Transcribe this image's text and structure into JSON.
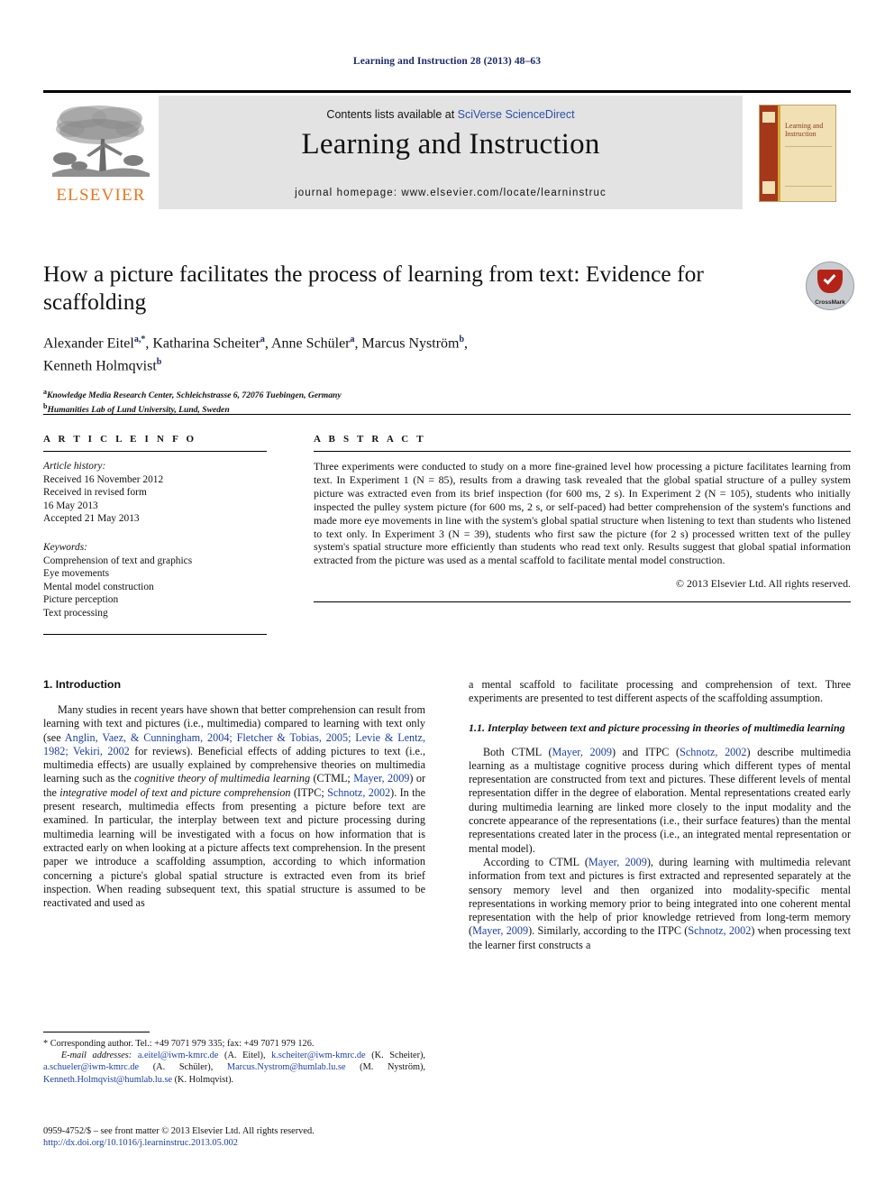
{
  "running_head": "Learning and Instruction 28 (2013) 48–63",
  "masthead": {
    "contents_prefix": "Contents lists available at ",
    "contents_link": "SciVerse ScienceDirect",
    "journal_title": "Learning and Instruction",
    "homepage": "journal homepage: www.elsevier.com/locate/learninstruc",
    "publisher_wordmark": "ELSEVIER",
    "cover_title": "Learning and Instruction"
  },
  "crossmark": {
    "label": "CrossMark"
  },
  "article": {
    "title": "How a picture facilitates the process of learning from text: Evidence for scaffolding",
    "authors_line1": "Alexander Eitel a,*, Katharina Scheiter a, Anne Schüler a, Marcus Nyström b,",
    "authors_line2": "Kenneth Holmqvist b",
    "affiliation_a": "Knowledge Media Research Center, Schleichstrasse 6, 72076 Tuebingen, Germany",
    "affiliation_b": "Humanities Lab of Lund University, Lund, Sweden"
  },
  "article_info": {
    "heading": "A R T I C L E   I N F O",
    "history_label": "Article history:",
    "history": [
      "Received 16 November 2012",
      "Received in revised form",
      "16 May 2013",
      "Accepted 21 May 2013"
    ],
    "keywords_label": "Keywords:",
    "keywords": [
      "Comprehension of text and graphics",
      "Eye movements",
      "Mental model construction",
      "Picture perception",
      "Text processing"
    ]
  },
  "abstract": {
    "heading": "A B S T R A C T",
    "text": "Three experiments were conducted to study on a more fine-grained level how processing a picture facilitates learning from text. In Experiment 1 (N = 85), results from a drawing task revealed that the global spatial structure of a pulley system picture was extracted even from its brief inspection (for 600 ms, 2 s). In Experiment 2 (N = 105), students who initially inspected the pulley system picture (for 600 ms, 2 s, or self-paced) had better comprehension of the system's functions and made more eye movements in line with the system's global spatial structure when listening to text than students who listened to text only. In Experiment 3 (N = 39), students who first saw the picture (for 2 s) processed written text of the pulley system's spatial structure more efficiently than students who read text only. Results suggest that global spatial information extracted from the picture was used as a mental scaffold to facilitate mental model construction.",
    "copyright": "© 2013 Elsevier Ltd. All rights reserved."
  },
  "body": {
    "section1_heading": "1. Introduction",
    "p1_a": "Many studies in recent years have shown that better comprehension can result from learning with text and pictures (i.e., multimedia) compared to learning with text only (see ",
    "p1_refs1": "Anglin, Vaez, & Cunningham, 2004; Fletcher & Tobias, 2005; Levie & Lentz, 1982; Vekiri, 2002",
    "p1_b": " for reviews). Beneficial effects of adding pictures to text (i.e., multimedia effects) are usually explained by comprehensive theories on multimedia learning such as the ",
    "p1_ital1": "cognitive theory of multimedia learning",
    "p1_c": " (CTML; ",
    "p1_ref2": "Mayer, 2009",
    "p1_d": ") or the ",
    "p1_ital2": "integrative model of text and picture comprehension",
    "p1_e": " (ITPC; ",
    "p1_ref3": "Schnotz, 2002",
    "p1_f": "). In the present research, multimedia effects from presenting a picture before text are examined. In particular, the interplay between text and picture processing during multimedia learning will be investigated with a focus on how information that is extracted early on when looking at a picture affects text comprehension. In the present paper we introduce a scaffolding assumption, according to which information concerning a picture's global spatial structure is extracted even from its brief inspection. When reading subsequent text, this spatial structure is assumed to be reactivated and used as",
    "p1_cont": "a mental scaffold to facilitate processing and comprehension of text. Three experiments are presented to test different aspects of the scaffolding assumption.",
    "subsection11_heading": "1.1. Interplay between text and picture processing in theories of multimedia learning",
    "p2_a": "Both CTML (",
    "p2_ref1": "Mayer, 2009",
    "p2_b": ") and ITPC (",
    "p2_ref2": "Schnotz, 2002",
    "p2_c": ") describe multimedia learning as a multistage cognitive process during which different types of mental representation are constructed from text and pictures. These different levels of mental representation differ in the degree of elaboration. Mental representations created early during multimedia learning are linked more closely to the input modality and the concrete appearance of the representations (i.e., their surface features) than the mental representations created later in the process (i.e., an integrated mental representation or mental model).",
    "p3_a": "According to CTML (",
    "p3_ref1": "Mayer, 2009",
    "p3_b": "), during learning with multimedia relevant information from text and pictures is first extracted and represented separately at the sensory memory level and then organized into modality-specific mental representations in working memory prior to being integrated into one coherent mental representation with the help of prior knowledge retrieved from long-term memory (",
    "p3_ref2": "Mayer, 2009",
    "p3_c": "). Similarly, according to the ITPC (",
    "p3_ref3": "Schnotz, 2002",
    "p3_d": ") when processing text the learner first constructs a"
  },
  "footnote": {
    "corresponding": "* Corresponding author. Tel.: +49 7071 979 335; fax: +49 7071 979 126.",
    "email_label": "E-mail addresses:",
    "emails": [
      {
        "mail": "a.eitel@iwm-kmrc.de",
        "who": " (A. Eitel), "
      },
      {
        "mail": "k.scheiter@iwm-kmrc.de",
        "who": " (K. Scheiter), "
      },
      {
        "mail": "a.schueler@iwm-kmrc.de",
        "who": " (A. Schüler), "
      },
      {
        "mail": "Marcus.Nystrom@humlab.lu.se",
        "who": " (M. Nyström), "
      },
      {
        "mail": "Kenneth.Holmqvist@humlab.lu.se",
        "who": " (K. Holmqvist)."
      }
    ]
  },
  "imprint": {
    "issn_line": "0959-4752/$ – see front matter © 2013 Elsevier Ltd. All rights reserved.",
    "doi": "http://dx.doi.org/10.1016/j.learninstruc.2013.05.002"
  },
  "colors": {
    "link_blue": "#2b4ea8",
    "ref_blue": "#1b3fa0",
    "runhead_blue": "#1b2a6b",
    "elsevier_orange": "#e87722",
    "masthead_gray": "#e3e3e3",
    "crossmark_red": "#b32317"
  }
}
